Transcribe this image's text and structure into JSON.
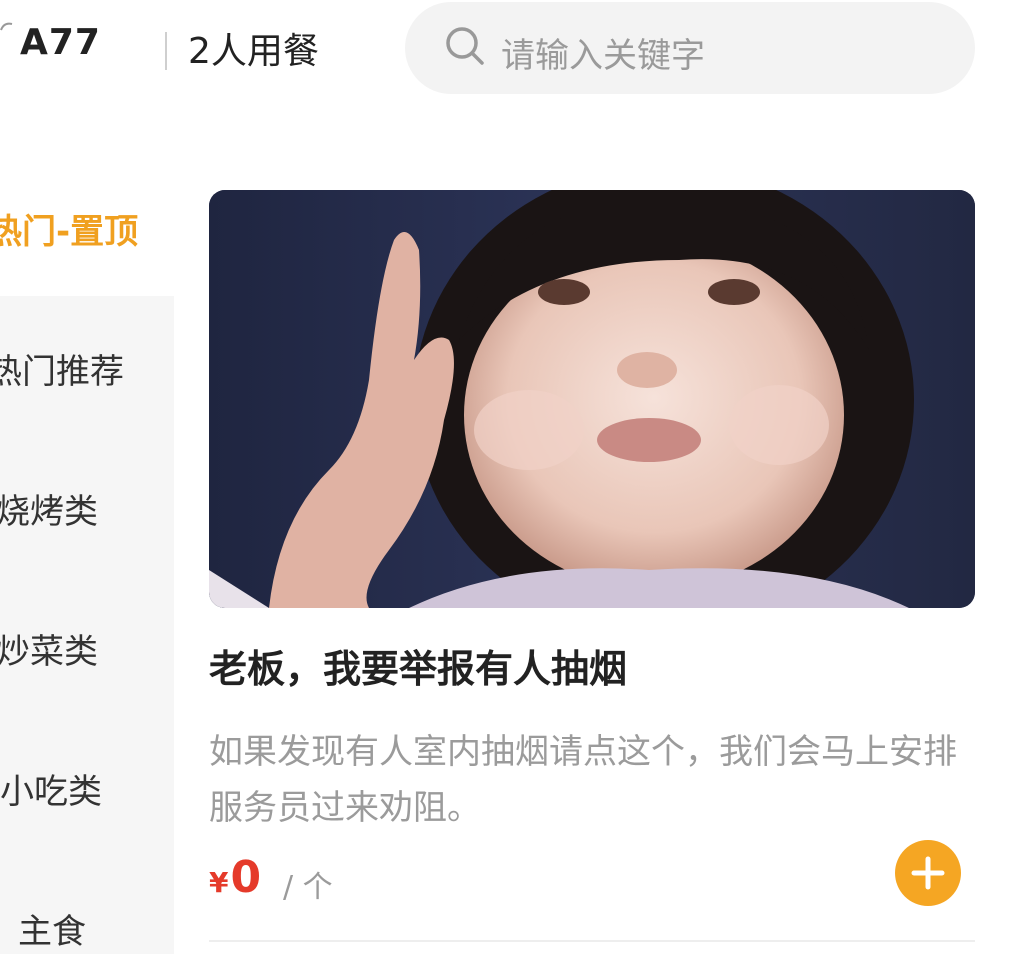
{
  "header": {
    "table_no": "A77",
    "party_size": "2人用餐"
  },
  "search": {
    "placeholder": "请输入关键字"
  },
  "sidebar": {
    "active": "热门-置顶",
    "items": [
      {
        "label": "热门推荐"
      },
      {
        "label": "烧烤类"
      },
      {
        "label": "炒菜类"
      },
      {
        "label": "小吃类"
      },
      {
        "label": "主食"
      }
    ]
  },
  "product": {
    "title": "老板，我要举报有人抽烟",
    "description": "如果发现有人室内抽烟请点这个，我们会马上安排服务员过来劝阻。",
    "price_symbol": "¥",
    "price": "0",
    "unit": "/ 个"
  },
  "colors": {
    "accent": "#f5a623",
    "active_label": "#f0a020",
    "price": "#e53a2a"
  },
  "icons": {
    "search": "search-icon",
    "add": "plus-icon"
  }
}
